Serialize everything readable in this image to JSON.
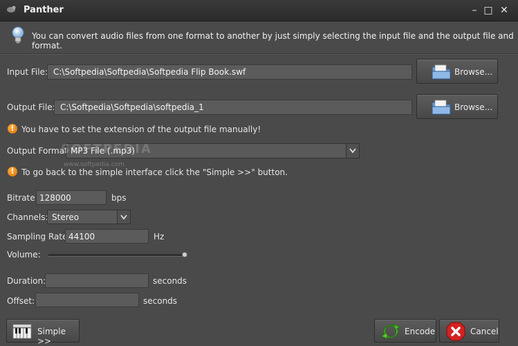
{
  "window": {
    "title": "Panther",
    "minimize": "–",
    "maximize": "□",
    "close": "✕"
  },
  "info_text": "You can convert audio files from one format to another by just simply selecting the input file and the output file and format.",
  "input_file": {
    "label": "Input File:",
    "value": "C:\\Softpedia\\Softpedia\\Softpedia Flip Book.swf",
    "browse_label": "Browse..."
  },
  "output_file": {
    "label": "Output File:",
    "value": "C:\\Softpedia\\Softpedia\\softpedia_1",
    "browse_label": "Browse..."
  },
  "warning_extension": "You have to set the extension of the output file manually!",
  "output_format": {
    "label": "Output Format:",
    "value": "MP3 File (.mp3)"
  },
  "warning_simple": "To go back to the simple interface click the \"Simple >>\" button.",
  "bitrate": {
    "label": "Bitrate:",
    "value": "128000",
    "unit": "bps"
  },
  "channels": {
    "label": "Channels:",
    "value": "Stereo"
  },
  "sampling_rate": {
    "label": "Sampling Rate:",
    "value": "44100",
    "unit": "Hz"
  },
  "volume": {
    "label": "Volume:",
    "level": 1.0
  },
  "duration": {
    "label": "Duration:",
    "value": "",
    "unit": "seconds"
  },
  "offset": {
    "label": "Offset:",
    "value": "",
    "unit": "seconds"
  },
  "buttons": {
    "simple": "Simple >>",
    "encode": "Encode",
    "cancel": "Cancel"
  },
  "watermark": {
    "text": "SOFTPEDIA",
    "url": "www.softpedia.com"
  },
  "colors": {
    "background": "#4a4a4a",
    "encode_arrow": "#4caf2e",
    "cancel_red": "#d32222",
    "warning": "#e88a10"
  }
}
